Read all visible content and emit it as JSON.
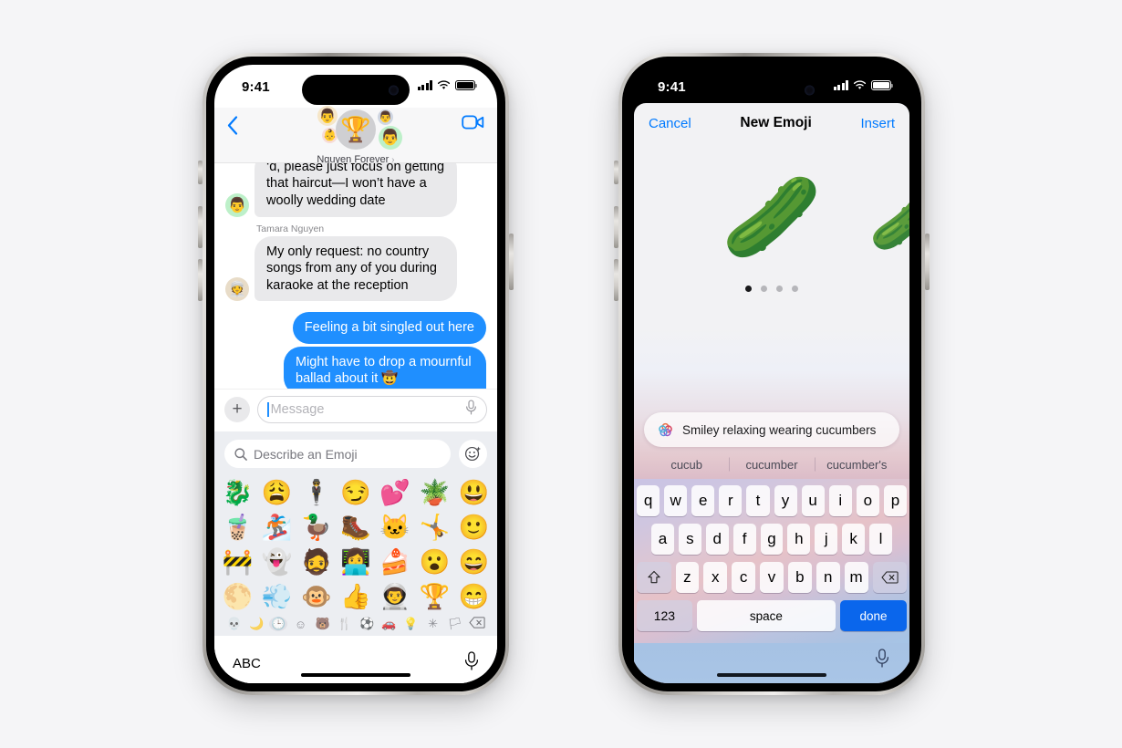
{
  "theme": {
    "ios_blue": "#007aff",
    "bubble_out": "#1f8fff",
    "bubble_in": "#e9e9eb",
    "key_blue": "#0a66ec",
    "panel_bg": "#eceef2"
  },
  "phone1": {
    "status": {
      "time": "9:41",
      "signal_icon": "cellular-bars-icon",
      "wifi_icon": "wifi-icon",
      "battery_icon": "battery-icon"
    },
    "nav": {
      "back_icon": "chevron-left-icon",
      "facetime_icon": "video-camera-icon",
      "conversation_name": "Nguyen Forever",
      "chevron": "›",
      "avatars": [
        {
          "name": "avatar-trophy",
          "glyph": "🏆"
        },
        {
          "name": "avatar-memoji-1",
          "glyph": "👨"
        },
        {
          "name": "avatar-memoji-2",
          "glyph": "👶"
        },
        {
          "name": "avatar-memoji-3",
          "glyph": "👨"
        },
        {
          "name": "avatar-memoji-4",
          "glyph": "👨"
        }
      ]
    },
    "messages": [
      {
        "direction": "in",
        "clipped": true,
        "sender": "",
        "avatar_glyph": "👨",
        "avatar_tone": "green",
        "text": "‘d, please just focus on getting that haircut—I won’t have a woolly wedding date"
      },
      {
        "direction": "in",
        "clipped": false,
        "sender": "Tamara Nguyen",
        "avatar_glyph": "👳",
        "avatar_tone": "tan",
        "text": "My only request: no country songs from any of you during karaoke at the reception"
      },
      {
        "direction": "out",
        "clipped": false,
        "sender": "",
        "avatar_glyph": "",
        "avatar_tone": "",
        "text": "Feeling a bit singled out here"
      },
      {
        "direction": "out",
        "clipped": false,
        "sender": "",
        "avatar_glyph": "",
        "avatar_tone": "",
        "text": "Might have to drop a mournful ballad about it 🤠"
      }
    ],
    "compose": {
      "plus_label": "+",
      "plus_icon": "plus-icon",
      "message_placeholder": "Message",
      "message_value": "",
      "mic_icon": "microphone-icon"
    },
    "emoji_panel": {
      "search_icon": "search-icon",
      "search_placeholder": "Describe an Emoji",
      "search_value": "",
      "genmoji_icon": "genmoji-sparkle-icon",
      "grid": [
        "🐉",
        "😩",
        "🕴️",
        "😏",
        "💕",
        "🪴",
        "😃",
        "🧋",
        "🏂",
        "🦆",
        "🥾",
        "🐱",
        "🤸",
        "🙂",
        "🚧",
        "👻",
        "🧔",
        "👩‍💻",
        "🍰",
        "😮",
        "😄",
        "🌕",
        "💨",
        "🐵",
        "👍",
        "👨‍🚀",
        "🏆",
        "😁"
      ],
      "categories": [
        {
          "name": "category-frequently-used",
          "glyph": "🕒",
          "selected": true
        },
        {
          "name": "category-smileys",
          "glyph": "☺",
          "selected": false
        },
        {
          "name": "category-animals",
          "glyph": "🐻",
          "selected": false
        },
        {
          "name": "category-food",
          "glyph": "🍴",
          "selected": false
        },
        {
          "name": "category-activity",
          "glyph": "⚽",
          "selected": false
        },
        {
          "name": "category-travel",
          "glyph": "🚗",
          "selected": false
        },
        {
          "name": "category-objects",
          "glyph": "💡",
          "selected": false
        },
        {
          "name": "category-symbols",
          "glyph": "✳",
          "selected": false
        },
        {
          "name": "category-flags",
          "glyph": "🏳",
          "selected": false
        }
      ],
      "cat_first": "💀",
      "cat_second": "🌙",
      "backspace_icon": "backspace-icon",
      "abc_label": "ABC",
      "dictation_icon": "microphone-icon"
    }
  },
  "phone2": {
    "status": {
      "time": "9:41",
      "signal_icon": "cellular-bars-icon",
      "wifi_icon": "wifi-icon",
      "battery_icon": "battery-icon"
    },
    "sheet": {
      "cancel_label": "Cancel",
      "title": "New Emoji",
      "insert_label": "Insert",
      "carousel": {
        "main_emoji": "🥒",
        "main_emoji_name": "genmoji-cucumber-smiley-relaxed",
        "side_emoji": "🥒",
        "side_emoji_name": "genmoji-cucumber-smiley-grinning",
        "page_count": 4,
        "active_page": 1
      },
      "prompt": {
        "icon": "apple-intelligence-icon",
        "text": "Smiley relaxing wearing cucumbers"
      },
      "suggestions": [
        "cucub",
        "cucumber",
        "cucumber's"
      ],
      "keyboard": {
        "row1": [
          "q",
          "w",
          "e",
          "r",
          "t",
          "y",
          "u",
          "i",
          "o",
          "p"
        ],
        "row2": [
          "a",
          "s",
          "d",
          "f",
          "g",
          "h",
          "j",
          "k",
          "l"
        ],
        "row3": [
          "z",
          "x",
          "c",
          "v",
          "b",
          "n",
          "m"
        ],
        "shift_icon": "shift-icon",
        "backspace_icon": "backspace-icon",
        "numbers_label": "123",
        "space_label": "space",
        "done_label": "done",
        "dictation_icon": "microphone-icon"
      }
    }
  }
}
